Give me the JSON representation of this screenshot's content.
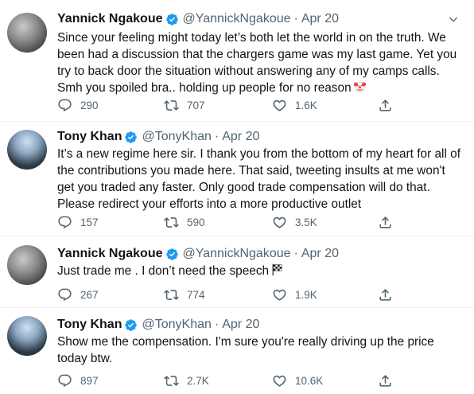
{
  "tweets": [
    {
      "name": "Yannick Ngakoue",
      "handle": "@YannickNgakoue",
      "date": "Apr 20",
      "text": "Since your feeling might today let’s both let the world in on the truth. We been had a discussion that the chargers game was my last game. Yet you try to back door the situation without answering any of my camps calls. Smh you spoiled bra.. holding up people for no reason",
      "emoji": "clown-face",
      "replies": "290",
      "retweets": "707",
      "likes": "1.6K"
    },
    {
      "name": "Tony Khan",
      "handle": "@TonyKhan",
      "date": "Apr 20",
      "text": "It’s a new regime here sir. I thank you from the bottom of my heart for all of the contributions you made here. That said, tweeting insults at me won't get you traded any faster. Only good trade compensation will do that. Please redirect your efforts into a more productive outlet",
      "emoji": "",
      "replies": "157",
      "retweets": "590",
      "likes": "3.5K"
    },
    {
      "name": "Yannick Ngakoue",
      "handle": "@YannickNgakoue",
      "date": "Apr 20",
      "text": "Just trade me . I don’t need the speech",
      "emoji": "checkered-flag",
      "replies": "267",
      "retweets": "774",
      "likes": "1.9K"
    },
    {
      "name": "Tony Khan",
      "handle": "@TonyKhan",
      "date": "Apr 20",
      "text": "Show me the compensation. I'm sure you're really driving up the price today btw.",
      "emoji": "",
      "replies": "897",
      "retweets": "2.7K",
      "likes": "10.6K"
    }
  ],
  "colors": {
    "verified": "#1d9bf0",
    "muted": "#536471",
    "text": "#0f1419"
  },
  "icons": [
    "verified-badge-icon",
    "caret-down-icon",
    "reply-icon",
    "retweet-icon",
    "like-icon",
    "share-icon",
    "clown-face-icon",
    "checkered-flag-icon"
  ]
}
